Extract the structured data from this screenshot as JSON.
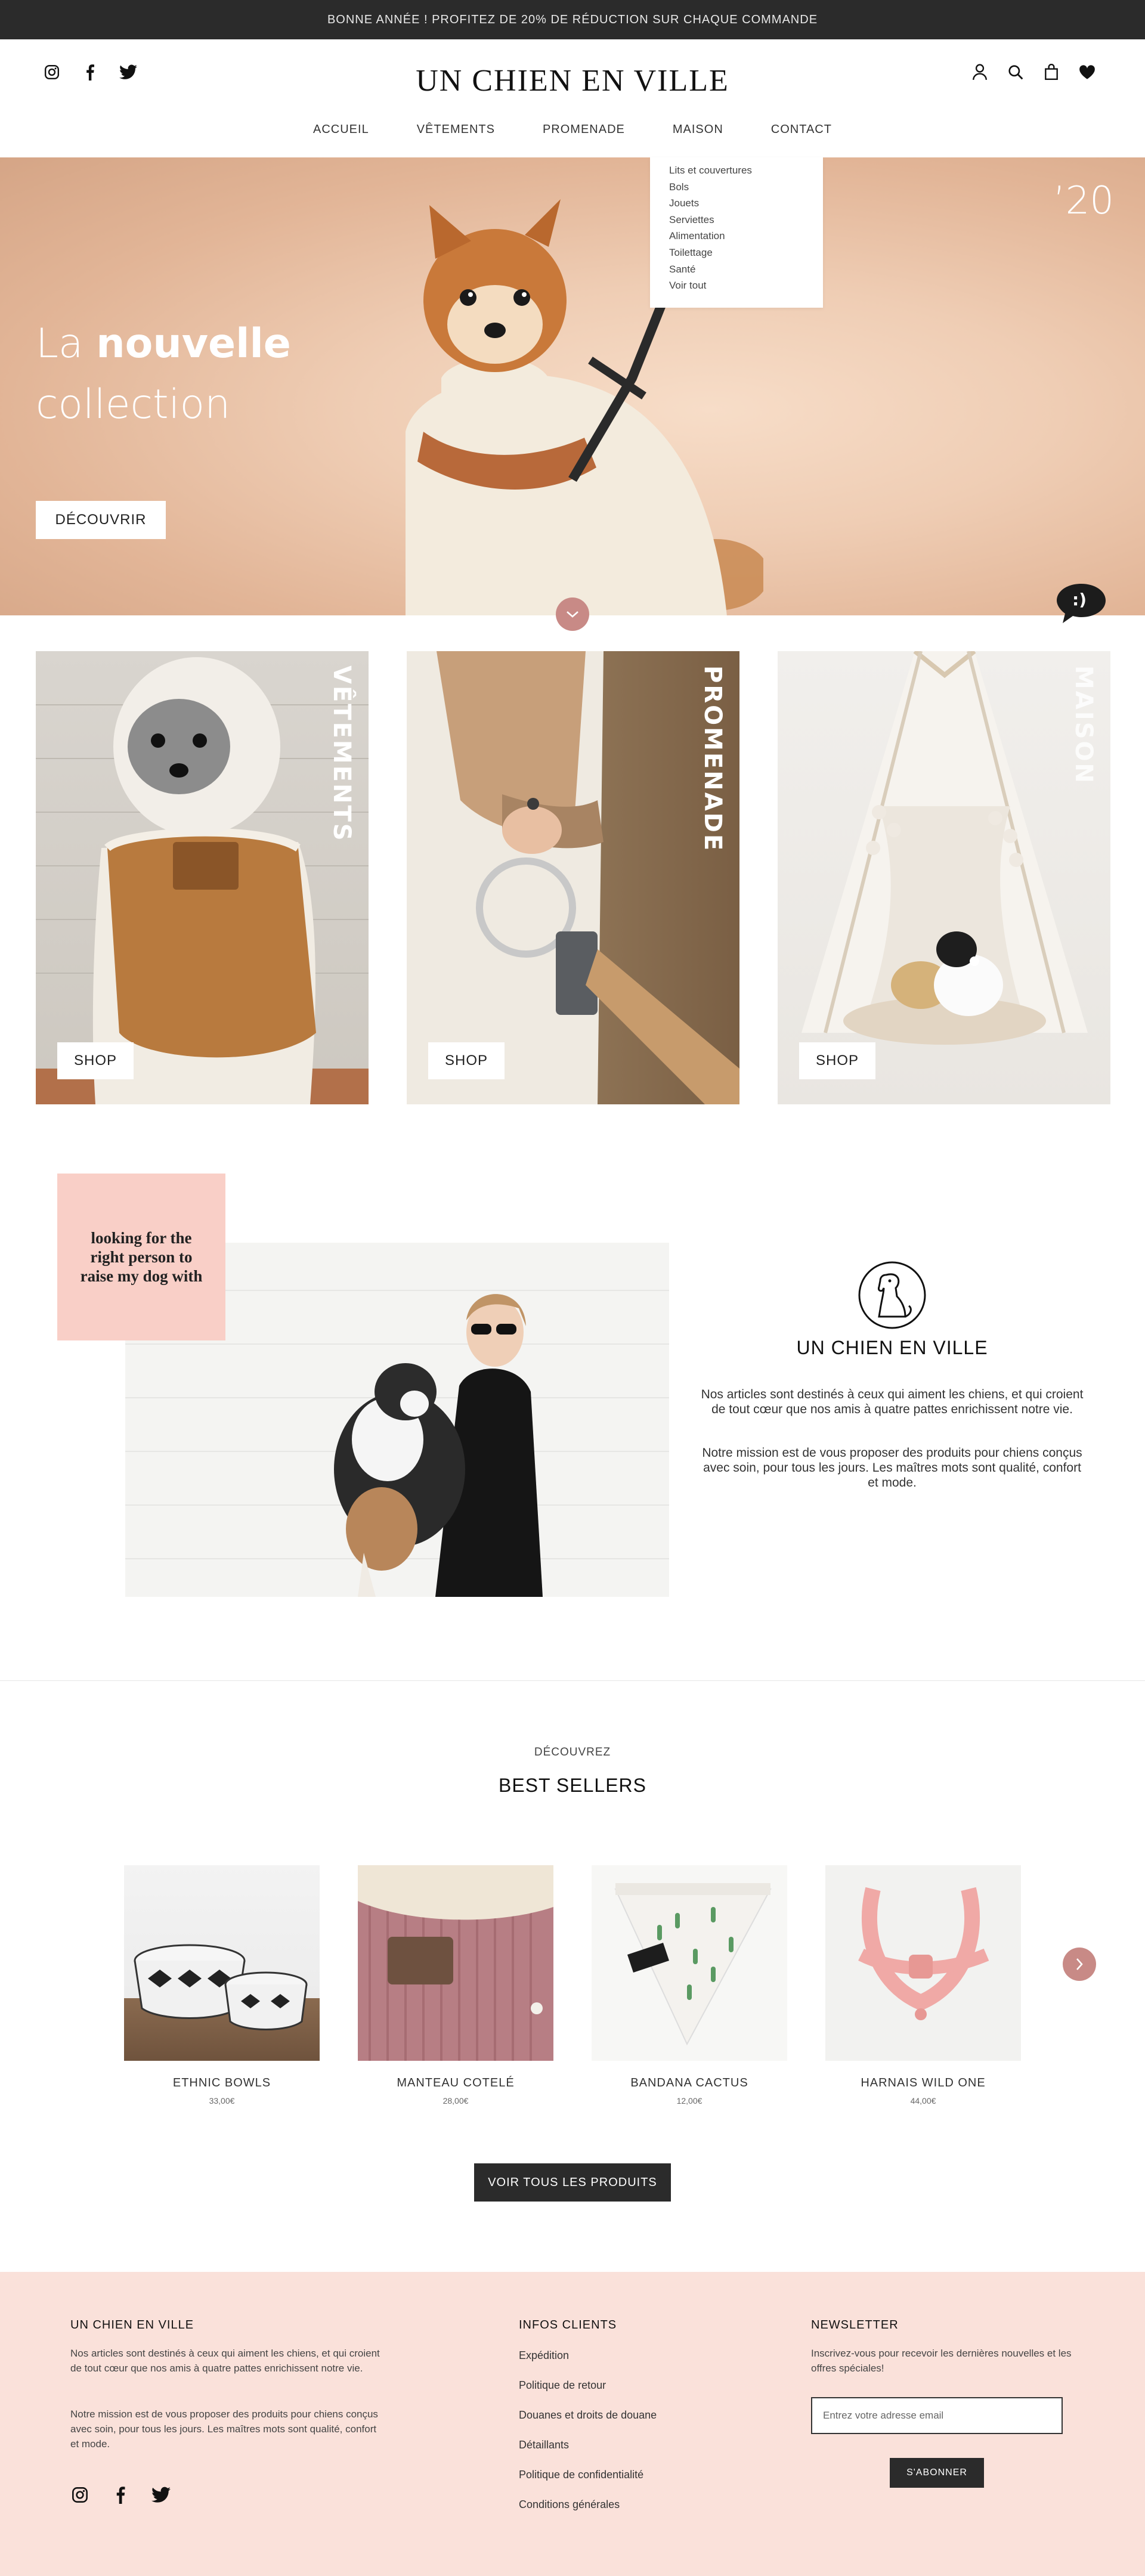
{
  "announcement": "BONNE ANNÉE ! PROFITEZ DE 20% DE RÉDUCTION SUR CHAQUE COMMANDE",
  "header": {
    "brand": "UN CHIEN EN VILLE",
    "social_icons": [
      "instagram-icon",
      "facebook-icon",
      "twitter-icon"
    ],
    "util_icons": [
      "account-icon",
      "search-icon",
      "bag-icon",
      "heart-icon"
    ],
    "nav": [
      "ACCUEIL",
      "VÊTEMENTS",
      "PROMENADE",
      "MAISON",
      "CONTACT"
    ]
  },
  "dropdown": {
    "parent": "MAISON",
    "items": [
      "Lits et couvertures",
      "Bols",
      "Jouets",
      "Serviettes",
      "Alimentation",
      "Toilettage",
      "Santé",
      "Voir tout"
    ]
  },
  "hero": {
    "title_prefix": "La",
    "title_bold": "nouvelle",
    "title_line2": "collection",
    "year": "’20",
    "cta": "DÉCOUVRIR",
    "chat_text": ":)"
  },
  "categories": [
    {
      "label": "VÊTEMENTS",
      "cta": "SHOP"
    },
    {
      "label": "PROMENADE",
      "cta": "SHOP"
    },
    {
      "label": "MAISON",
      "cta": "SHOP"
    }
  ],
  "about": {
    "quote": "looking for the right person to raise my dog with",
    "brand": "UN CHIEN EN VILLE",
    "p1": "Nos articles sont destinés à ceux qui aiment les chiens, et qui croient de tout cœur que nos amis à quatre pattes enrichissent notre vie.",
    "p2": "Notre mission est de vous proposer des produits pour chiens conçus avec soin, pour tous les jours. Les maîtres mots sont qualité, confort et mode."
  },
  "bestsellers": {
    "eyebrow": "DÉCOUVREZ",
    "title": "BEST SELLERS",
    "products": [
      {
        "name": "ETHNIC BOWLS",
        "price": "33,00€"
      },
      {
        "name": "MANTEAU COTELÉ",
        "price": "28,00€"
      },
      {
        "name": "BANDANA CACTUS",
        "price": "12,00€"
      },
      {
        "name": "HARNAIS WILD ONE",
        "price": "44,00€"
      }
    ],
    "view_all": "VOIR TOUS LES PRODUITS"
  },
  "footer": {
    "col1_title": "UN CHIEN EN VILLE",
    "col1_p1": "Nos articles sont destinés à ceux qui aiment les chiens, et qui croient de tout cœur que nos amis à quatre pattes enrichissent notre vie.",
    "col1_p2": "Notre mission est de vous proposer des produits pour chiens conçus avec soin, pour tous les jours. Les maîtres mots sont qualité, confort et mode.",
    "col2_title": "INFOS CLIENTS",
    "links": [
      "Expédition",
      "Politique de retour",
      "Douanes et droits de douane",
      "Détaillants",
      "Politique de confidentialité",
      "Conditions générales"
    ],
    "col3_title": "NEWSLETTER",
    "col3_p": "Inscrivez-vous pour recevoir les dernières nouvelles et les offres spéciales!",
    "email_placeholder": "Entrez votre adresse email",
    "subscribe": "S'ABONNER"
  },
  "colors": {
    "dark": "#2b2b2b",
    "accent_rose": "#c88a86",
    "quote_pink": "#f9cfc7",
    "footer_bg": "#fae1da"
  }
}
